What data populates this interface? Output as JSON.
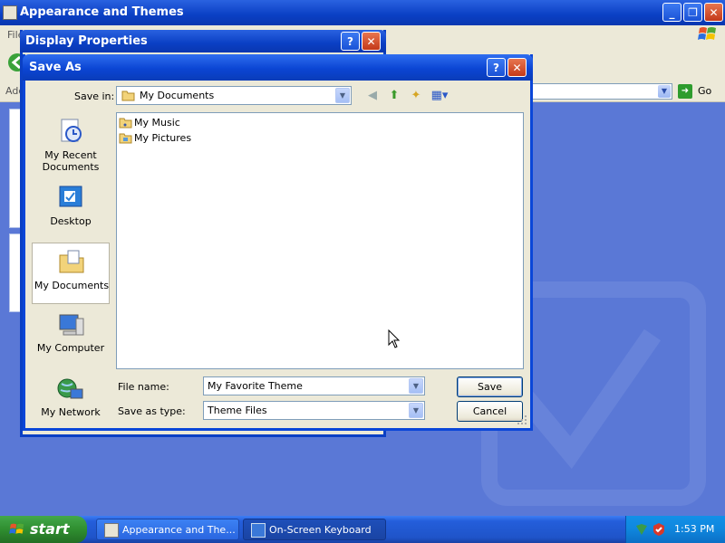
{
  "explorer": {
    "title": "Appearance and Themes",
    "menu_first": "File",
    "address_label": "Address",
    "go_label": "Go"
  },
  "display_properties": {
    "title": "Display Properties"
  },
  "save_as": {
    "title": "Save As",
    "save_in_label": "Save in:",
    "save_in_value": "My Documents",
    "places": [
      {
        "label": "My Recent Documents",
        "icon": "recent-documents-icon"
      },
      {
        "label": "Desktop",
        "icon": "desktop-icon"
      },
      {
        "label": "My Documents",
        "icon": "my-documents-icon"
      },
      {
        "label": "My Computer",
        "icon": "my-computer-icon"
      },
      {
        "label": "My Network",
        "icon": "my-network-icon"
      }
    ],
    "files": [
      {
        "label": "My Music",
        "icon": "music-folder-icon"
      },
      {
        "label": "My Pictures",
        "icon": "pictures-folder-icon"
      }
    ],
    "file_name_label": "File name:",
    "file_name_value": "My Favorite Theme",
    "save_as_type_label": "Save as type:",
    "save_as_type_value": "Theme Files",
    "save_button": "Save",
    "cancel_button": "Cancel"
  },
  "taskbar": {
    "start_label": "start",
    "tasks": [
      {
        "label": "Appearance and The..."
      },
      {
        "label": "On-Screen Keyboard"
      }
    ],
    "clock": "1:53 PM"
  },
  "colors": {
    "title_blue": "#0a46d8",
    "dialog_bg": "#ece9d8",
    "desktop": "#5a78d6",
    "start_green": "#2f8e30"
  }
}
